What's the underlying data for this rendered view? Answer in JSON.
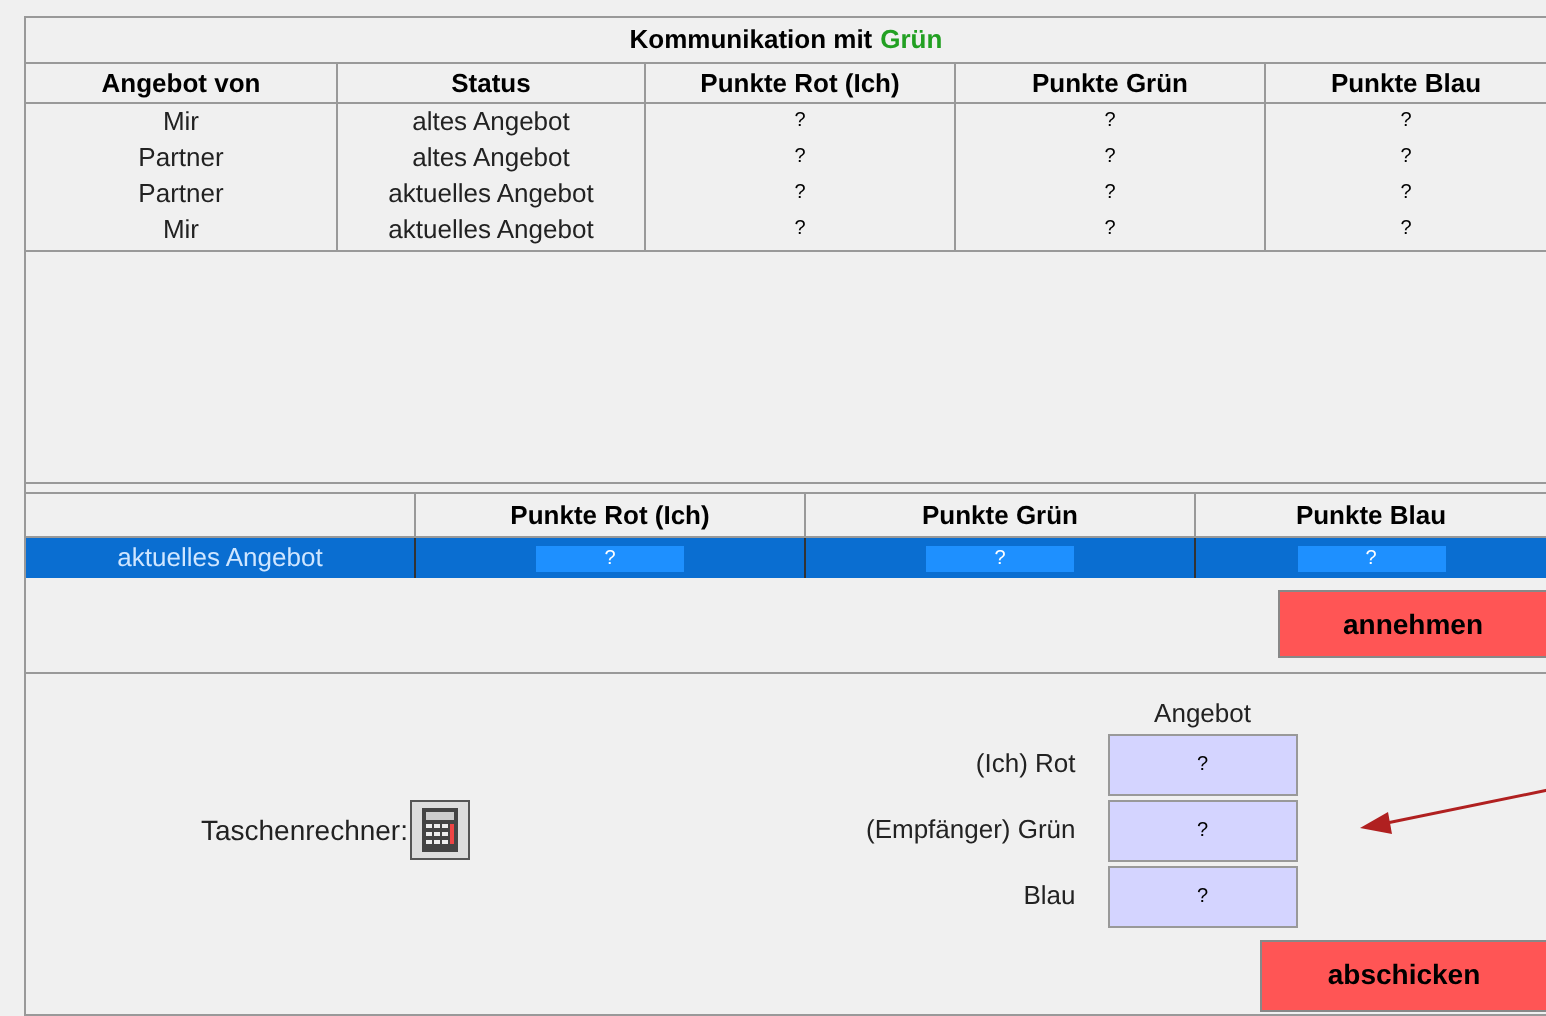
{
  "history": {
    "title": "Kommunikation mit",
    "partner": "Grün",
    "columns": [
      "Angebot von",
      "Status",
      "Punkte Rot (Ich)",
      "Punkte Grün",
      "Punkte Blau"
    ],
    "rows": [
      [
        "Mir",
        "altes Angebot",
        "?",
        "?",
        "?"
      ],
      [
        "Partner",
        "altes Angebot",
        "?",
        "?",
        "?"
      ],
      [
        "Partner",
        "aktuelles Angebot",
        "?",
        "?",
        "?"
      ],
      [
        "Mir",
        "aktuelles Angebot",
        "?",
        "?",
        "?"
      ]
    ]
  },
  "current": {
    "columns": [
      "Punkte Rot (Ich)",
      "Punkte Grün",
      "Punkte Blau"
    ],
    "rows": [
      {
        "label": "aktuelles Angebot",
        "values": [
          "?",
          "?",
          "?"
        ],
        "selected": true
      }
    ],
    "accept_button": "annehmen"
  },
  "offer": {
    "calculator_label": "Taschenrechner:",
    "heading": "Angebot",
    "fields": [
      {
        "label": "(Ich) Rot",
        "value": "?"
      },
      {
        "label": "(Empfänger) Grün",
        "value": "?"
      },
      {
        "label": "Blau",
        "value": "?"
      }
    ],
    "send_button": "abschicken"
  }
}
